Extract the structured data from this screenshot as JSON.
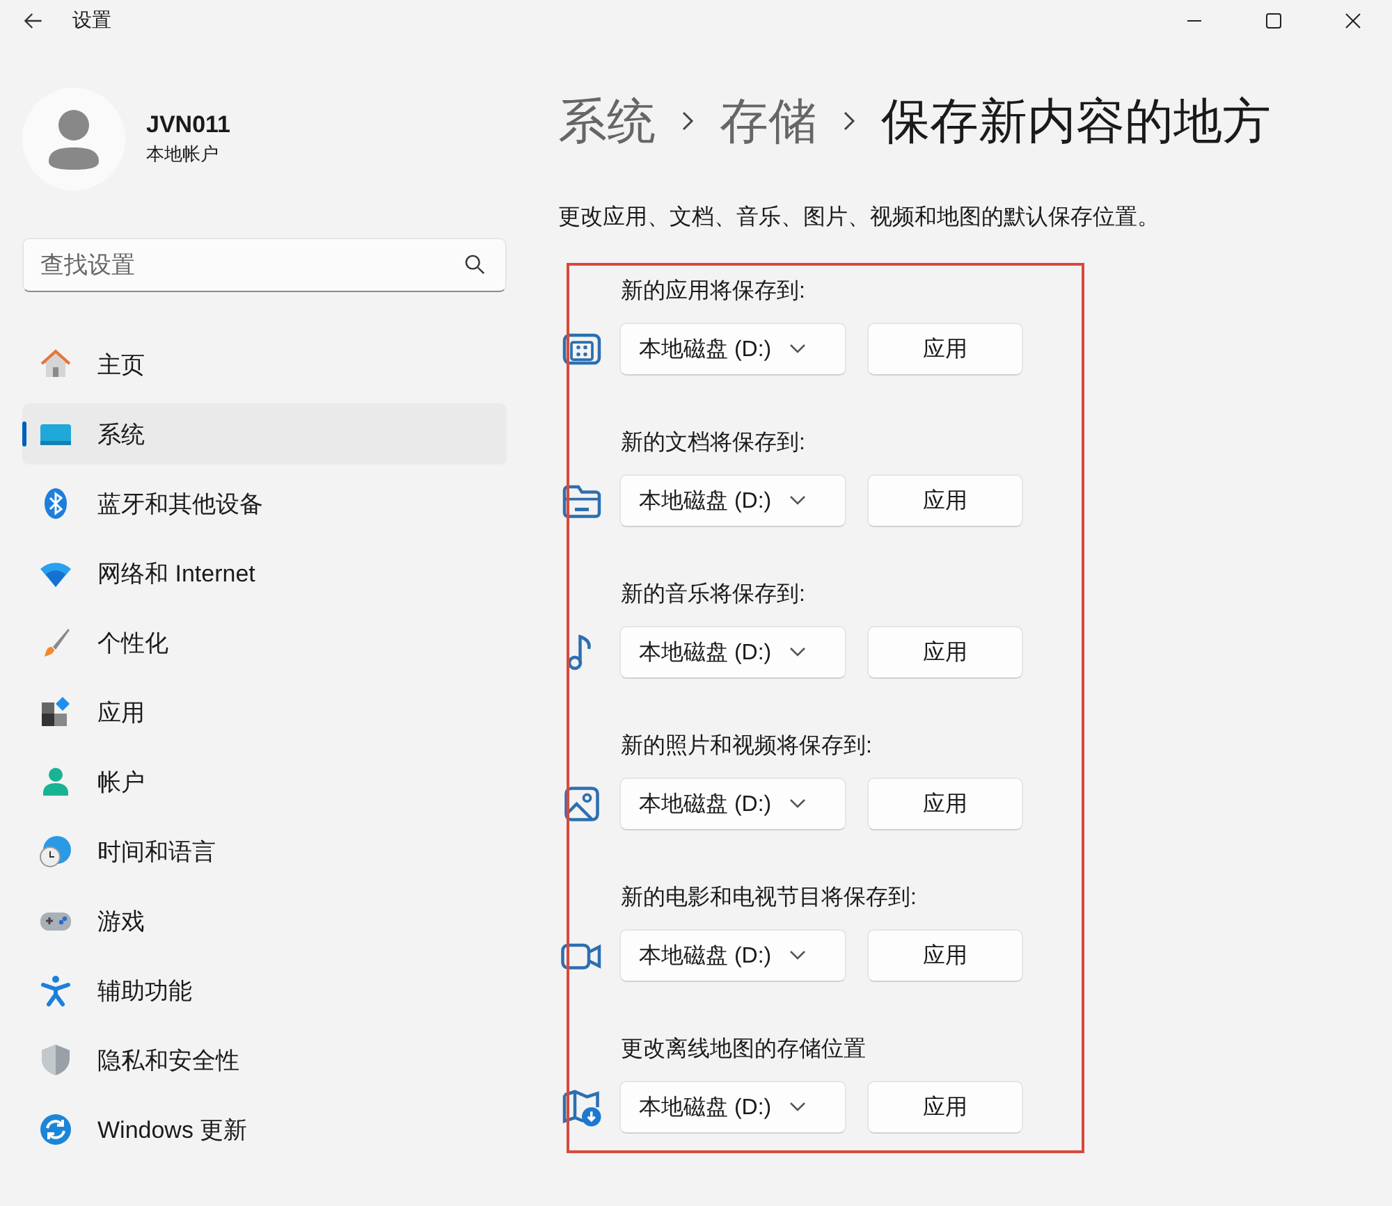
{
  "window": {
    "title": "设置"
  },
  "profile": {
    "name": "JVN011",
    "account_type": "本地帐户"
  },
  "search": {
    "placeholder": "查找设置"
  },
  "nav": [
    {
      "label": "主页",
      "selected": false
    },
    {
      "label": "系统",
      "selected": true
    },
    {
      "label": "蓝牙和其他设备",
      "selected": false
    },
    {
      "label": "网络和 Internet",
      "selected": false
    },
    {
      "label": "个性化",
      "selected": false
    },
    {
      "label": "应用",
      "selected": false
    },
    {
      "label": "帐户",
      "selected": false
    },
    {
      "label": "时间和语言",
      "selected": false
    },
    {
      "label": "游戏",
      "selected": false
    },
    {
      "label": "辅助功能",
      "selected": false
    },
    {
      "label": "隐私和安全性",
      "selected": false
    },
    {
      "label": "Windows 更新",
      "selected": false
    }
  ],
  "breadcrumb": [
    "系统",
    "存储",
    "保存新内容的地方"
  ],
  "description": "更改应用、文档、音乐、图片、视频和地图的默认保存位置。",
  "locations": [
    {
      "label": "新的应用将保存到:",
      "drive": "本地磁盘 (D:)",
      "button": "应用"
    },
    {
      "label": "新的文档将保存到:",
      "drive": "本地磁盘 (D:)",
      "button": "应用"
    },
    {
      "label": "新的音乐将保存到:",
      "drive": "本地磁盘 (D:)",
      "button": "应用"
    },
    {
      "label": "新的照片和视频将保存到:",
      "drive": "本地磁盘 (D:)",
      "button": "应用"
    },
    {
      "label": "新的电影和电视节目将保存到:",
      "drive": "本地磁盘 (D:)",
      "button": "应用"
    },
    {
      "label": "更改离线地图的存储位置",
      "drive": "本地磁盘 (D:)",
      "button": "应用"
    }
  ]
}
